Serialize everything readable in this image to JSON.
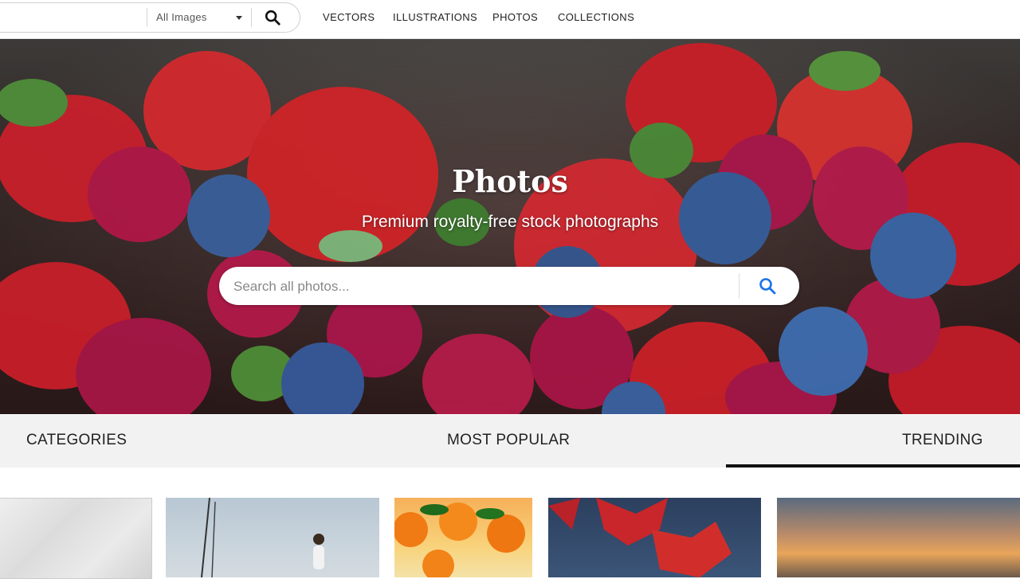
{
  "topbar": {
    "search_select": "All Images",
    "nav": [
      "VECTORS",
      "ILLUSTRATIONS",
      "PHOTOS",
      "COLLECTIONS"
    ]
  },
  "hero": {
    "title": "Photos",
    "subtitle": "Premium royalty-free stock photographs",
    "search_placeholder": "Search all photos..."
  },
  "tabs": [
    "CATEGORIES",
    "MOST POPULAR",
    "TRENDING"
  ],
  "active_tab": "TRENDING",
  "thumbnails": [
    "paper-texture",
    "runner-by-sailboat",
    "oranges-with-leaves",
    "red-maple-leaves",
    "sunset-sky"
  ],
  "colors": {
    "accent": "#1a73e8",
    "tab_underline": "#111111"
  }
}
